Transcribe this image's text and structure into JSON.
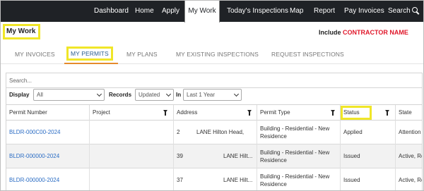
{
  "nav": {
    "items": [
      {
        "label": "Dashboard"
      },
      {
        "label": "Home"
      },
      {
        "label": "Apply"
      },
      {
        "label": "My Work"
      },
      {
        "label": "Today's Inspections"
      },
      {
        "label": "Map"
      },
      {
        "label": "Report"
      },
      {
        "label": "Pay Invoices"
      },
      {
        "label": "Search"
      }
    ],
    "active_index": 3
  },
  "header": {
    "title": "My Work",
    "include_label": "Include",
    "contractor_name": "CONTRACTOR NAME"
  },
  "tabs": [
    {
      "label": "MY INVOICES"
    },
    {
      "label": "MY PERMITS"
    },
    {
      "label": "MY PLANS"
    },
    {
      "label": "MY EXISTING INSPECTIONS"
    },
    {
      "label": "REQUEST INSPECTIONS"
    }
  ],
  "active_tab": 1,
  "filters": {
    "search_placeholder": "Search...",
    "display_label": "Display",
    "display_value": "All",
    "records_label": "Records",
    "records_value": "Updated",
    "in_label": "In",
    "in_value": "Last 1 Year"
  },
  "table": {
    "headers": [
      "Permit Number",
      "Project",
      "Address",
      "Permit Type",
      "Status",
      "State"
    ],
    "rows": [
      {
        "permit": "BLDR-000C00-2024",
        "project": "",
        "addr_num": "2",
        "addr_street": "LANE Hilton Head,",
        "type": "Building - Residential - New Residence",
        "status": "Applied",
        "state": "Attention"
      },
      {
        "permit": "BLDR-000000-2024",
        "project": "",
        "addr_num": "39",
        "addr_street": "LANE Hilt...",
        "type": "Building - Residential - New Residence",
        "status": "Issued",
        "state": "Active, Re"
      },
      {
        "permit": "BLDR-000000-2024",
        "project": "",
        "addr_num": "37",
        "addr_street": "LANE Hilt...",
        "type": "Building - Residential - New Residence",
        "status": "Issued",
        "state": "Active, Re"
      }
    ]
  },
  "colors": {
    "nav_bg": "#1f2226",
    "highlight": "#f0e628",
    "link": "#2a6cc4",
    "contractor": "#e0172a",
    "tab_underline": "#e58b2c"
  }
}
